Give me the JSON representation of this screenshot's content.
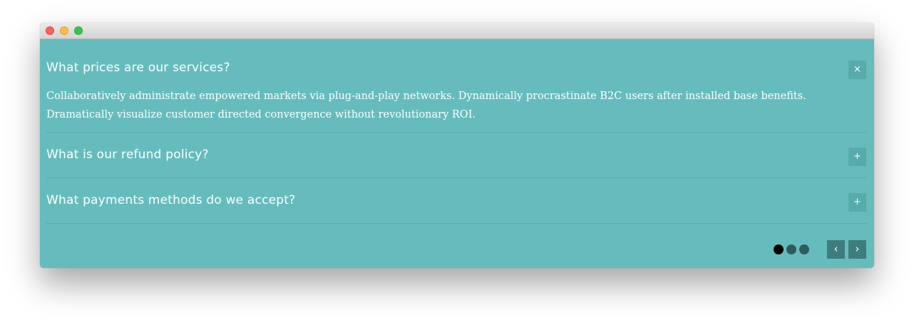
{
  "window": {
    "controls": [
      "close",
      "minimize",
      "zoom"
    ]
  },
  "faq": {
    "items": [
      {
        "question": "What prices are our services?",
        "toggle": "×",
        "expanded": true,
        "answer_lines": [
          "Collaboratively administrate empowered markets via plug-and-play networks. Dynamically procrastinate B2C users after installed base benefits.",
          "Dramatically visualize customer directed convergence without revolutionary ROI."
        ]
      },
      {
        "question": "What is our refund policy?",
        "toggle": "+",
        "expanded": false
      },
      {
        "question": "What payments methods do we accept?",
        "toggle": "+",
        "expanded": false
      }
    ]
  },
  "pagination": {
    "pages": 3,
    "active_index": 0,
    "colors": {
      "active": "#000000",
      "inactive": "#2e5c5c"
    },
    "prev_label": "‹",
    "next_label": "›"
  },
  "colors": {
    "background": "#66bcbc",
    "toggle_bg": "#56abab",
    "nav_bg": "#3e7d7d",
    "divider": "#58a9a9",
    "text": "#ffffff"
  }
}
